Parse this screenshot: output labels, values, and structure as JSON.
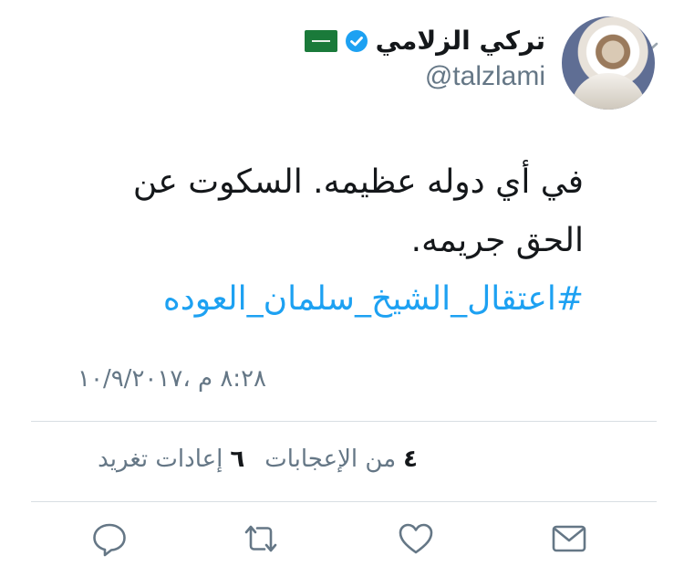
{
  "tweet": {
    "author": {
      "display_name": "تركي الزلامي",
      "handle": "@talzlami",
      "verified": true,
      "flag_icon": "saudi-flag-icon"
    },
    "text": "في أي دوله عظيمه. السكوت عن الحق جريمه.",
    "hashtag": "#اعتقال_الشيخ_سلمان_العوده",
    "timestamp": "٨:٢٨ م ،١٠/٩/٢٠١٧",
    "stats": {
      "retweets_count": "٦",
      "retweets_label": "إعادات تغريد",
      "likes_count": "٤",
      "likes_label": "من الإعجابات"
    }
  },
  "colors": {
    "link": "#1da1f2",
    "secondary_text": "#657786",
    "icon_gray": "#657786",
    "divider": "#d8dee3",
    "flag_green": "#1a7a3a"
  },
  "icons": {
    "menu": "chevron-down-icon",
    "verified": "verified-badge-icon",
    "reply": "reply-icon",
    "retweet": "retweet-icon",
    "like": "heart-icon",
    "message": "envelope-icon"
  }
}
